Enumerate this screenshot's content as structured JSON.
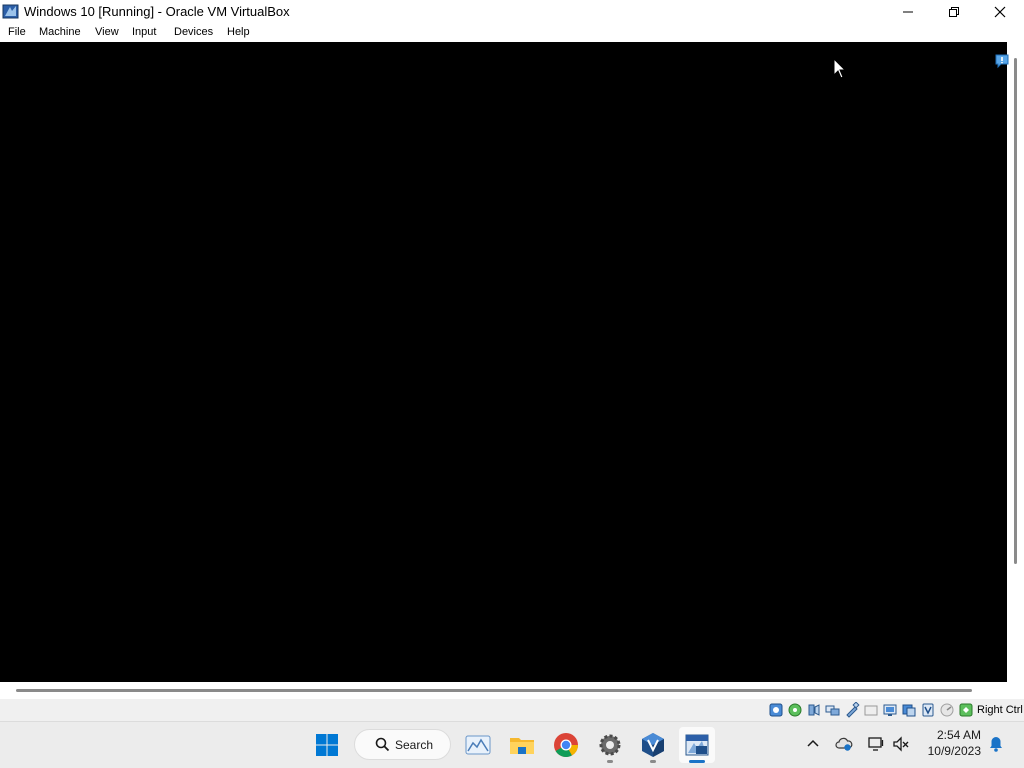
{
  "window": {
    "title": "Windows 10 [Running] - Oracle VM VirtualBox"
  },
  "menu": {
    "items": [
      {
        "label": "File"
      },
      {
        "label": "Machine"
      },
      {
        "label": "View"
      },
      {
        "label": "Input"
      },
      {
        "label": "Devices"
      },
      {
        "label": "Help"
      }
    ]
  },
  "statusbar": {
    "host_key": "Right Ctrl",
    "indicators": [
      "hard-disk-icon",
      "optical-drive-icon",
      "audio-icon",
      "network-icon",
      "usb-icon",
      "shared-folders-icon",
      "display-icon",
      "video-capture-icon",
      "mouse-integration-icon",
      "cpu-icon",
      "keyboard-capture-icon"
    ]
  },
  "taskbar": {
    "search_label": "Search",
    "clock_time": "2:54 AM",
    "clock_date": "10/9/2023"
  },
  "colors": {
    "vm_screen": "#000000",
    "accent": "#1a73c7",
    "windows_blue": "#0078d4"
  }
}
